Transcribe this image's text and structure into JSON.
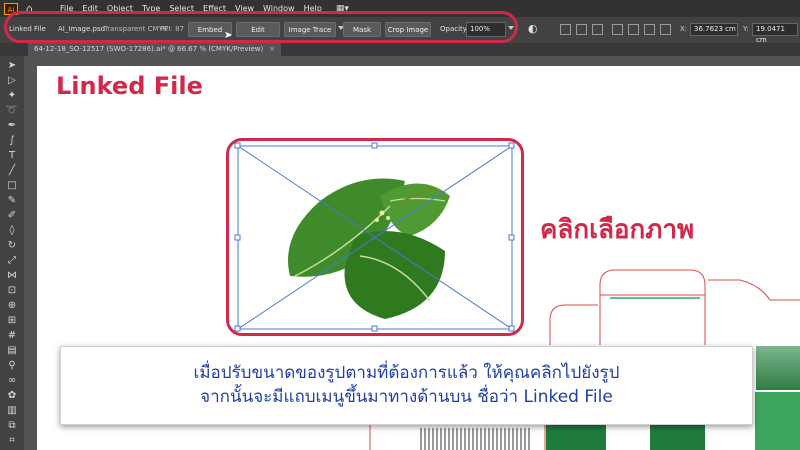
{
  "app": {
    "logo": "Ai",
    "home_icon": "home-icon"
  },
  "menu": [
    "File",
    "Edit",
    "Object",
    "Type",
    "Select",
    "Effect",
    "View",
    "Window",
    "Help"
  ],
  "control_bar": {
    "linked_file_label": "Linked File",
    "file_name": "AI_Image.psd",
    "color_mode": "Transparent CMYK",
    "ppi": "PPI: 87",
    "embed_button": "Embed",
    "edit_original_button": "Edit Original",
    "image_trace_button": "Image Trace",
    "mask_button": "Mask",
    "crop_image_button": "Crop Image",
    "opacity_label": "Opacity:",
    "opacity_value": "100%",
    "x_label": "X:",
    "x_value": "36.7623 cm",
    "y_label": "Y:",
    "y_value": "19.0471 cm"
  },
  "document_tab": {
    "title": "64-12-18_SO-12517 (SWO-17286).ai* @ 66.67 % (CMYK/Preview)",
    "close": "×"
  },
  "tools": [
    "selection-tool",
    "direct-selection-tool",
    "magic-wand-tool",
    "lasso-tool",
    "pen-tool",
    "curvature-tool",
    "type-tool",
    "line-tool",
    "rectangle-tool",
    "paintbrush-tool",
    "shaper-tool",
    "eraser-tool",
    "rotate-tool",
    "scale-tool",
    "width-tool",
    "free-transform-tool",
    "shape-builder-tool",
    "perspective-grid-tool",
    "mesh-tool",
    "gradient-tool",
    "eyedropper-tool",
    "blend-tool",
    "symbol-sprayer-tool",
    "column-graph-tool",
    "artboard-tool",
    "slice-tool",
    "hand-tool",
    "zoom-tool"
  ],
  "canvas": {
    "title": "Linked File",
    "side_label": "คลิกเลือกภาพ",
    "caption_line1": "เมื่อปรับขนาดของรูปตามที่ต้องการแล้ว ให้คุณคลิกไปยังรูป",
    "caption_line2": "จากนั้นจะมีแถบเมนูขึ้นมาทางด้านบน ชื่อว่า Linked File"
  },
  "colors": {
    "accent": "#d2294a",
    "caption_text": "#1f3fa8",
    "selection": "#4a78d8",
    "leaf": "#2f7a1f",
    "dieline": "#d94a4a"
  }
}
